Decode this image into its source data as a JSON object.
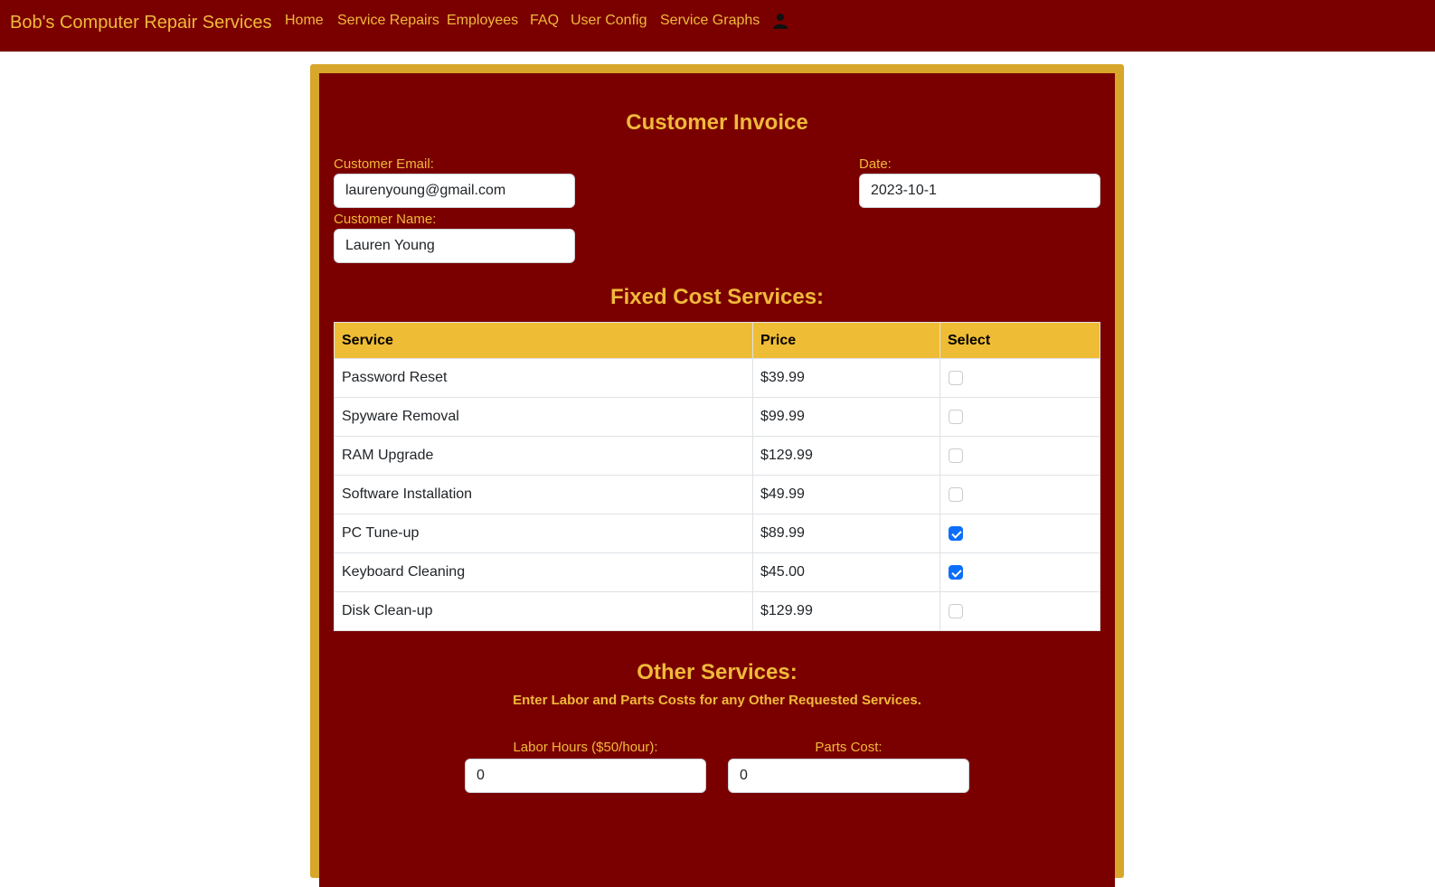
{
  "navbar": {
    "brand": "Bob's Computer Repair Services",
    "links": [
      "Home",
      "Service Repairs",
      "Employees",
      "FAQ",
      "User Config",
      "Service Graphs"
    ],
    "user_icon": "person-icon"
  },
  "invoice": {
    "title": "Customer Invoice",
    "email_label": "Customer Email:",
    "email_value": "laurenyoung@gmail.com",
    "name_label": "Customer Name:",
    "name_value": "Lauren Young",
    "date_label": "Date:",
    "date_value": "2023-10-1"
  },
  "fixed": {
    "title": "Fixed Cost Services:",
    "headers": [
      "Service",
      "Price",
      "Select"
    ],
    "rows": [
      {
        "service": "Password Reset",
        "price": "$39.99",
        "selected": false
      },
      {
        "service": "Spyware Removal",
        "price": "$99.99",
        "selected": false
      },
      {
        "service": "RAM Upgrade",
        "price": "$129.99",
        "selected": false
      },
      {
        "service": "Software Installation",
        "price": "$49.99",
        "selected": false
      },
      {
        "service": "PC Tune-up",
        "price": "$89.99",
        "selected": true
      },
      {
        "service": "Keyboard Cleaning",
        "price": "$45.00",
        "selected": true
      },
      {
        "service": "Disk Clean-up",
        "price": "$129.99",
        "selected": false
      }
    ]
  },
  "other": {
    "title": "Other Services:",
    "subtitle": "Enter Labor and Parts Costs for any Other Requested Services.",
    "labor_label": "Labor Hours ($50/hour):",
    "labor_value": "0",
    "parts_label": "Parts Cost:",
    "parts_value": "0"
  },
  "colors": {
    "primary": "#7a0000",
    "accent": "#f0b93a",
    "frame": "#d9a62c"
  }
}
